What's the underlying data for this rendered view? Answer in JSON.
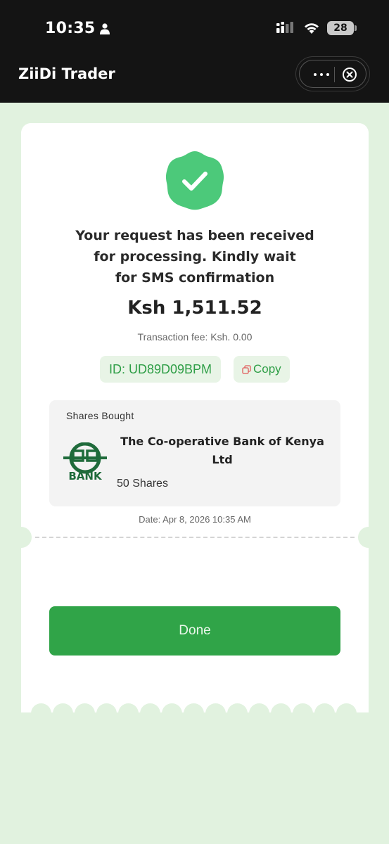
{
  "status_bar": {
    "time": "10:35",
    "battery": "28"
  },
  "header": {
    "title": "ZiiDi Trader"
  },
  "receipt": {
    "message_lines": [
      "Your request has been received",
      "for processing. Kindly wait",
      "for SMS confirmation"
    ],
    "amount": "Ksh 1,511.52",
    "fee": "Transaction fee: Ksh. 0.00",
    "transaction_id": "ID: UD89D09BPM",
    "copy_label": "Copy",
    "shares": {
      "section_title": "Shares Bought",
      "company_line1": "The Co-operative Bank of Kenya",
      "company_line2": "Ltd",
      "count": "50 Shares",
      "logo_text": "BANK"
    },
    "date": "Date: Apr 8, 2026 10:35 AM",
    "done_label": "Done"
  },
  "colors": {
    "accent_green": "#30a448",
    "badge_green": "#4cc97a",
    "background": "#e1f2df",
    "header_dark": "#141414"
  }
}
